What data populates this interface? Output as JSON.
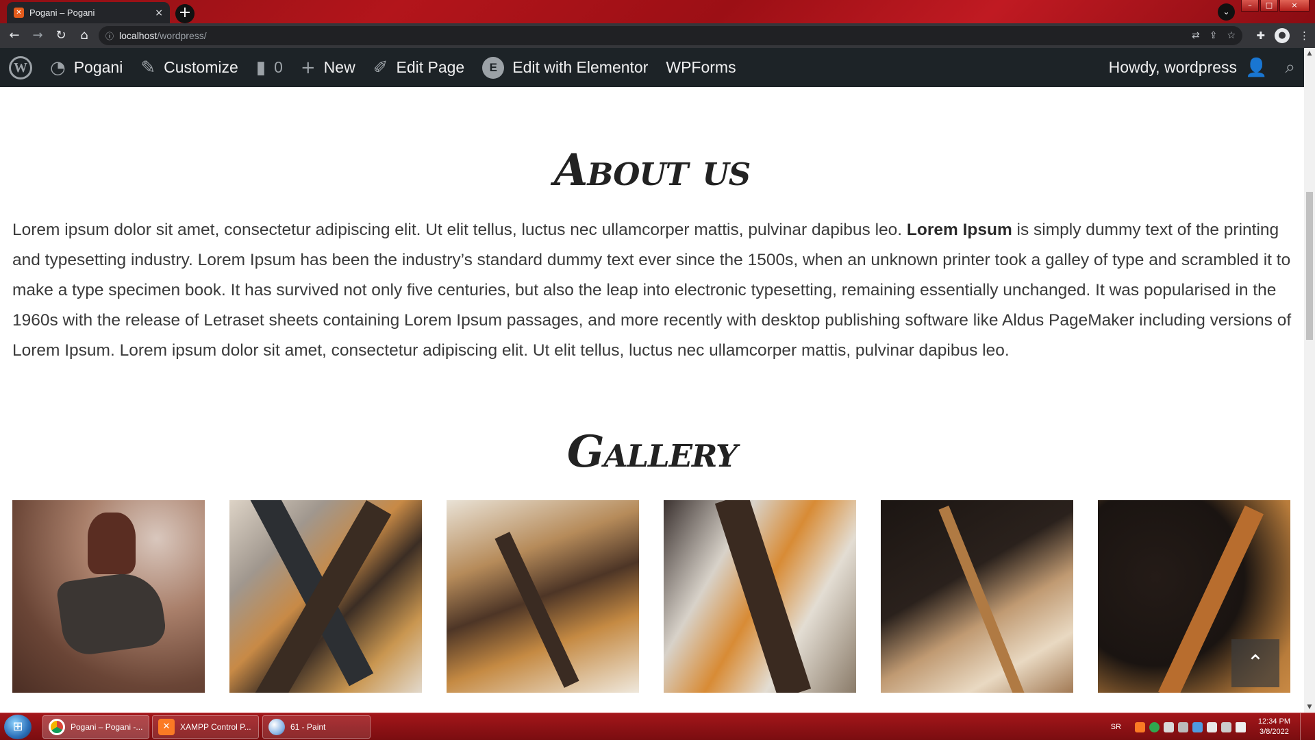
{
  "browser": {
    "tab_title": "Pogani – Pogani",
    "tab_favicon": "xampp-favicon",
    "tab_close": "×",
    "new_tab": "+",
    "tab_search": "⌄",
    "window_controls": {
      "minimize": "–",
      "maximize": "□",
      "close": "×"
    },
    "url_host": "localhost",
    "url_path": "/wordpress/",
    "nav": {
      "back": "←",
      "forward": "→",
      "reload": "↻",
      "home": "⌂"
    },
    "omnibox_icons": [
      "translate-icon",
      "share-icon",
      "star-icon"
    ],
    "toolbar_icons": [
      "extensions-icon",
      "profile-icon",
      "menu-icon"
    ]
  },
  "adminbar": {
    "items": [
      {
        "label": "",
        "icon": "wordpress-logo"
      },
      {
        "label": "Pogani",
        "icon": "dashboard-icon"
      },
      {
        "label": "Customize",
        "icon": "brush-icon"
      },
      {
        "label": "0",
        "icon": "comment-icon"
      },
      {
        "label": "New",
        "icon": "plus-icon"
      },
      {
        "label": "Edit Page",
        "icon": "pencil-icon"
      },
      {
        "label": "Edit with Elementor",
        "icon": "elementor-icon"
      },
      {
        "label": "WPForms",
        "icon": ""
      }
    ],
    "howdy": "Howdy, wordpress",
    "search_icon": "search-icon"
  },
  "page": {
    "about_heading": "About us",
    "about_text_1": "Lorem ipsum dolor sit amet, consectetur adipiscing elit. Ut elit tellus, luctus nec ullamcorper mattis, pulvinar dapibus leo. ",
    "about_text_bold": "Lorem Ipsum",
    "about_text_2": " is simply dummy text of the printing and typesetting industry. Lorem Ipsum has been the industry’s standard dummy text ever since the 1500s, when an unknown printer took a galley of type and scrambled it to make a type specimen book. It has survived not only five centuries, but also the leap into electronic typesetting, remaining essentially unchanged. It was popularised in the 1960s with the release of Letraset sheets containing Lorem Ipsum passages, and more recently with desktop publishing software like Aldus PageMaker including versions of Lorem Ipsum. Lorem ipsum dolor sit amet, consectetur adipiscing elit. Ut elit tellus, luctus nec ullamcorper mattis, pulvinar dapibus leo.",
    "gallery_heading": "Gallery",
    "gallery_count": 6,
    "back_to_top": "^"
  },
  "taskbar": {
    "buttons": [
      {
        "label": "Pogani – Pogani -...",
        "icon": "chrome-icon"
      },
      {
        "label": "XAMPP Control P...",
        "icon": "xampp-icon"
      },
      {
        "label": "61 - Paint",
        "icon": "paint-icon"
      }
    ],
    "language": "SR",
    "clock_time": "12:34 PM",
    "clock_date": "3/8/2022"
  },
  "colors": {
    "adminbar_bg": "#1d2327",
    "taskbar_red": "#a3161a",
    "heading_text": "#222222",
    "body_text": "#3a3a3a"
  }
}
